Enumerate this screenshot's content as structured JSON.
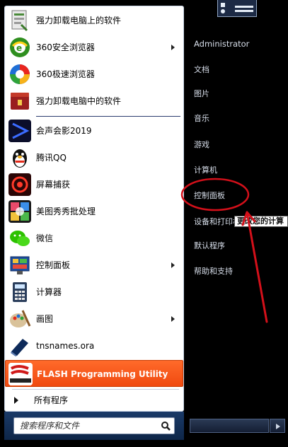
{
  "pinned": [
    {
      "label": "强力卸载电脑上的软件",
      "icon": "uninstaller-icon",
      "arrow": false
    },
    {
      "label": "360安全浏览器",
      "icon": "browser-360-icon",
      "arrow": true
    },
    {
      "label": "360极速浏览器",
      "icon": "browser-360-speed-icon",
      "arrow": false
    },
    {
      "label": "强力卸载电脑中的软件",
      "icon": "uninstall-box-icon",
      "arrow": false
    }
  ],
  "recent": [
    {
      "label": "会声会影2019",
      "icon": "video-editor-icon",
      "arrow": false
    },
    {
      "label": "腾讯QQ",
      "icon": "qq-penguin-icon",
      "arrow": false
    },
    {
      "label": "屏幕捕获",
      "icon": "screen-capture-icon",
      "arrow": false
    },
    {
      "label": "美图秀秀批处理",
      "icon": "meitu-icon",
      "arrow": false
    },
    {
      "label": "微信",
      "icon": "wechat-icon",
      "arrow": false
    },
    {
      "label": "控制面板",
      "icon": "control-panel-icon",
      "arrow": true
    },
    {
      "label": "计算器",
      "icon": "calculator-icon",
      "arrow": false
    },
    {
      "label": "画图",
      "icon": "paint-icon",
      "arrow": true
    },
    {
      "label": "tnsnames.ora",
      "icon": "file-icon",
      "arrow": false
    },
    {
      "label": "FLASH Programming Utility",
      "icon": "silicon-labs-icon",
      "arrow": false
    }
  ],
  "all_programs": "所有程序",
  "search": {
    "placeholder": "搜索程序和文件"
  },
  "right": [
    "Administrator",
    "文档",
    "图片",
    "音乐",
    "游戏",
    "计算机",
    "控制面板",
    "设备和打印机",
    "默认程序",
    "帮助和支持"
  ],
  "tooltip": "更改您的计算",
  "colors": {
    "highlight": "#f04a10",
    "annotation": "#d4101a"
  }
}
